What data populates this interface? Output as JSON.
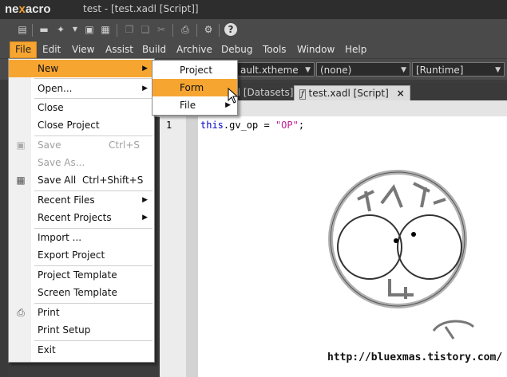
{
  "app": {
    "logo": "nexacro",
    "window_title": "test - [test.xadl [Script]]"
  },
  "toolbar": {
    "icons": [
      "new-project-icon",
      "open-folder-icon",
      "new-file-icon",
      "save-icon",
      "save-all-icon",
      "copy-icon",
      "paste-icon",
      "cut-icon",
      "print-icon",
      "settings-icon",
      "help-icon"
    ]
  },
  "menubar": {
    "items": [
      "File",
      "Edit",
      "View",
      "Assist",
      "Build",
      "Archive",
      "Debug",
      "Tools",
      "Window",
      "Help"
    ]
  },
  "configbar": {
    "theme": "ault.xtheme",
    "profile": "(none)",
    "runtime": "[Runtime]"
  },
  "tabs": [
    {
      "label": "ml [Datasets]"
    },
    {
      "label": "test.xadl [Script]",
      "close": "×"
    }
  ],
  "file_menu": {
    "items": [
      {
        "label": "New",
        "shortcut": "",
        "has_sub": true,
        "highlight": true
      },
      {
        "label": "Open...",
        "shortcut": "",
        "has_sub": true
      },
      {
        "label": "Close"
      },
      {
        "label": "Close Project"
      },
      {
        "label": "Save",
        "shortcut": "Ctrl+S",
        "disabled": true
      },
      {
        "label": "Save As...",
        "disabled": true
      },
      {
        "label": "Save All",
        "shortcut": "Ctrl+Shift+S"
      },
      {
        "label": "Recent Files",
        "has_sub": true
      },
      {
        "label": "Recent Projects",
        "has_sub": true
      },
      {
        "label": "Import ..."
      },
      {
        "label": "Export Project"
      },
      {
        "label": "Project Template"
      },
      {
        "label": "Screen Template"
      },
      {
        "label": "Print"
      },
      {
        "label": "Print Setup"
      },
      {
        "label": "Exit"
      }
    ]
  },
  "new_submenu": {
    "items": [
      {
        "label": "Project"
      },
      {
        "label": "Form",
        "highlight": true
      },
      {
        "label": "File",
        "has_sub": true
      }
    ]
  },
  "editor": {
    "line_number": "1",
    "code_keyword": "this",
    "code_middle": ".gv_op = ",
    "code_string": "\"OP\"",
    "code_end": ";"
  },
  "watermark": {
    "text": "http://bluexmas.tistory.com/"
  }
}
